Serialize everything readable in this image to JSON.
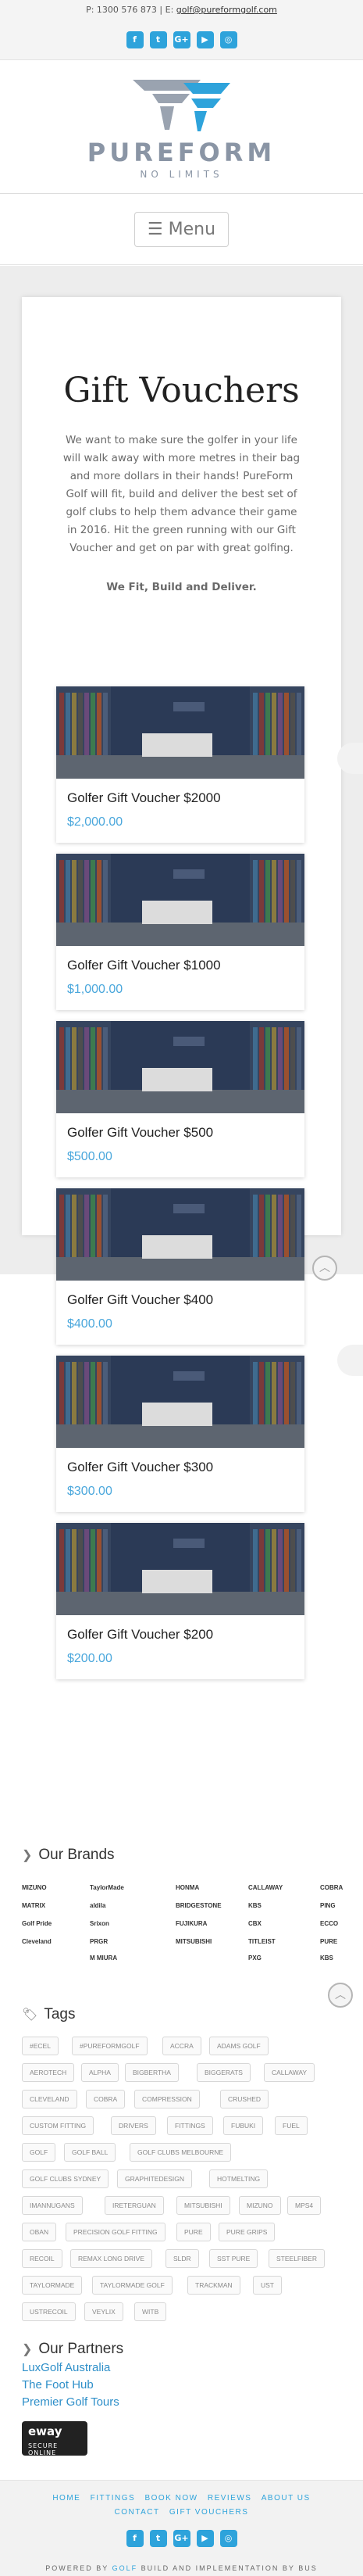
{
  "topbar": {
    "phone": "P: 1300 576 873",
    "separator": "|",
    "email_prefix": "E:",
    "email": "golf@pureformgolf.com"
  },
  "social": [
    {
      "name": "facebook-icon",
      "glyph": "f"
    },
    {
      "name": "twitter-icon",
      "glyph": "t"
    },
    {
      "name": "google-plus-icon",
      "glyph": "G+"
    },
    {
      "name": "youtube-icon",
      "glyph": "▶"
    },
    {
      "name": "instagram-icon",
      "glyph": "◎"
    }
  ],
  "logo": {
    "name": "PUREFORM",
    "tagline": "NO LIMITS"
  },
  "menu": {
    "glyph": "☰",
    "label": "Menu"
  },
  "page": {
    "title": "Gift Vouchers",
    "intro": "We want to make sure the golfer in your life will walk away with more metres in their bag and more dollars in their hands! PureForm Golf will fit, build and deliver the best set of golf clubs to help them advance their game in 2016. Hit the green running with our Gift Voucher and get on par with great golfing.",
    "tagline": "We Fit, Build and Deliver."
  },
  "products": [
    {
      "name": "Golfer Gift Voucher $2000",
      "price": "$2,000.00"
    },
    {
      "name": "Golfer Gift Voucher $1000",
      "price": "$1,000.00"
    },
    {
      "name": "Golfer Gift Voucher $500",
      "price": "$500.00"
    },
    {
      "name": "Golfer Gift Voucher $400",
      "price": "$400.00"
    },
    {
      "name": "Golfer Gift Voucher $300",
      "price": "$300.00"
    },
    {
      "name": "Golfer Gift Voucher $200",
      "price": "$200.00"
    }
  ],
  "brands": {
    "heading": "Our Brands",
    "items": [
      "MIZUNO",
      "TaylorMade",
      "HONMA",
      "CALLAWAY",
      "COBRA",
      "MATRIX",
      "aldila",
      "BRIDGESTONE",
      "KBS",
      "PING",
      "Golf Pride",
      "Srixon",
      "FUJIKURA",
      "CBX",
      "ECCO",
      "CleveIand",
      "PRGR",
      "MITSUBISHI",
      "TITLEIST",
      "PURE",
      "",
      "M MIURA",
      "",
      "PXG",
      "KBS"
    ]
  },
  "tags": {
    "heading": "Tags",
    "items": [
      "#ECEL",
      "#PUREFORMGOLF",
      "ACCRA",
      "ADAMS GOLF",
      "AEROTECH",
      "ALPHA",
      "BIGBERTHA",
      "BIGGERATS",
      "CALLAWAY",
      "CLEVELAND",
      "COBRA",
      "COMPRESSION",
      "CRUSHED",
      "CUSTOM FITTING",
      "DRIVERS",
      "FITTINGS",
      "FUBUKI",
      "FUEL",
      "GOLF",
      "GOLF BALL",
      "GOLF CLUBS MELBOURNE",
      "GOLF CLUBS SYDNEY",
      "GRAPHITEDESIGN",
      "HOTMELTING",
      "IMANNUGANS",
      "IRETERGUAN",
      "MITSUBISHI",
      "MIZUNO",
      "MPS4",
      "OBAN",
      "PRECISION GOLF FITTING",
      "PURE",
      "PURE GRIPS",
      "RECOIL",
      "REMAX LONG DRIVE",
      "SLDR",
      "SST PURE",
      "STEELFIBER",
      "TAYLORMADE",
      "TAYLORMADE GOLF",
      "TRACKMAN",
      "UST",
      "USTRECOIL",
      "VEYLIX",
      "WITB"
    ]
  },
  "partners": {
    "heading": "Our Partners",
    "items": [
      "LuxGolf Australia",
      "The Foot Hub",
      "Premier Golf Tours"
    ]
  },
  "eway": {
    "brand": "eway",
    "caption": "SECURE ONLINE"
  },
  "footer": {
    "nav_row1": [
      "HOME",
      "FITTINGS",
      "BOOK NOW",
      "REVIEWS",
      "ABOUT US"
    ],
    "nav_row2": [
      "CONTACT",
      "GIFT VOUCHERS"
    ],
    "powered_prefix": "POWERED BY",
    "powered_brand": "GOLF",
    "powered_suffix": "BUILD AND IMPLEMENTATION BY BUS"
  },
  "colors": {
    "accent": "#2ea3db",
    "price": "#4aa7dc",
    "logo": "#8a95a5"
  }
}
